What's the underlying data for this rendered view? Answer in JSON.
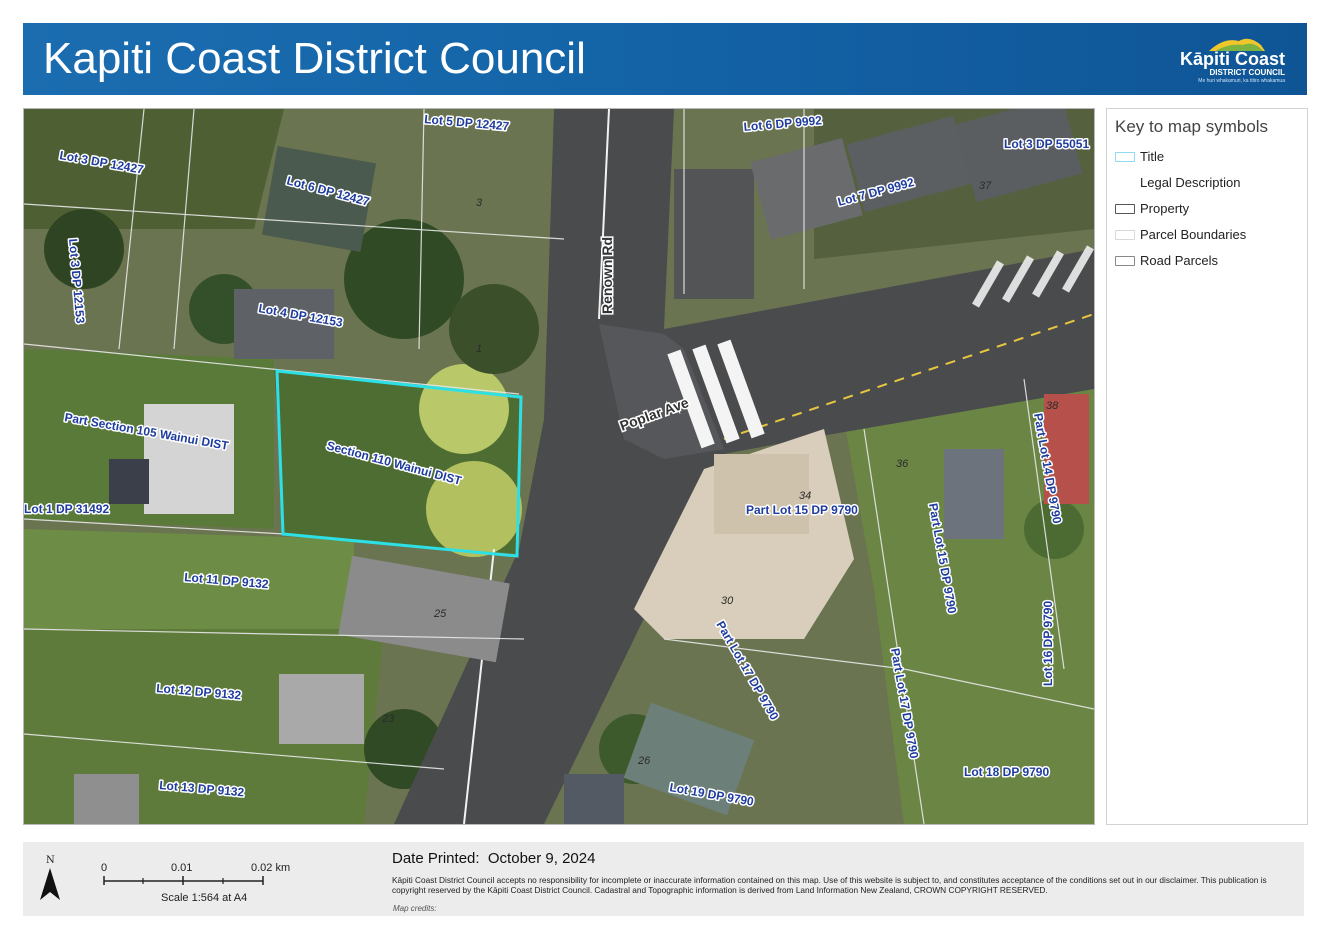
{
  "header": {
    "title": "Kapiti Coast District Council",
    "logo_text": "Kāpiti Coast",
    "logo_subtext": "DISTRICT COUNCIL",
    "logo_tagline": "Me huri whakamuri, ka titiro whakamua"
  },
  "colors": {
    "header_blue": "#1464a8",
    "title_outline": "#2de0e6",
    "label_blue": "#1e3c9e"
  },
  "map": {
    "parcel_labels": [
      "Lot 5 DP 12427",
      "Lot 3 DP 12427",
      "Lot 6 DP 12427",
      "Lot 3 DP 12153",
      "Lot 4 DP 12153",
      "Part Section 105 Wainui DIST",
      "Section 110 Wainui DIST",
      "Lot 1 DP 31492",
      "Lot 11 DP 9132",
      "Lot 12 DP 9132",
      "Lot 13 DP 9132",
      "Lot 6 DP 9992",
      "Lot 7 DP 9992",
      "Lot 3 DP 55051",
      "Part Lot 14 DP 9790",
      "Part Lot 15 DP 9790",
      "Part Lot 15 DP 9790",
      "Part Lot 17 DP 9790",
      "Part Lot 17 DP 9790",
      "Lot 16 DP 9790",
      "Lot 18 DP 9790",
      "Lot 19 DP 9790"
    ],
    "road_labels": [
      "Renown Rd",
      "Poplar Ave"
    ],
    "street_numbers": [
      "3",
      "1",
      "25",
      "23",
      "26",
      "30",
      "34",
      "36",
      "38",
      "37"
    ]
  },
  "legend": {
    "title": "Key to map symbols",
    "items": [
      {
        "label": "Title",
        "color": "#8fd9f5"
      },
      {
        "label": "Legal Description",
        "color": ""
      },
      {
        "label": "Property",
        "color": "#555555"
      },
      {
        "label": "Parcel Boundaries",
        "color": "#d8d8d8"
      },
      {
        "label": "Road Parcels",
        "color": "#888888"
      }
    ]
  },
  "footer": {
    "north": "N",
    "scale_ticks": [
      "0",
      "0.01",
      "0.02 km"
    ],
    "scale_label": "Scale 1:564 at A4",
    "date_label": "Date Printed:",
    "date_value": "October 9, 2024",
    "disclaimer": "Kāpiti Coast District Council accepts no responsibility for incomplete or inaccurate information contained on this map. Use of this website is subject to, and constitutes acceptance of the conditions set out in our disclaimer. This publication is copyright reserved by the Kāpiti Coast District Council. Cadastral and Topographic information is derived from Land Information New Zealand, CROWN COPYRIGHT RESERVED.",
    "credits": "Map credits:"
  }
}
